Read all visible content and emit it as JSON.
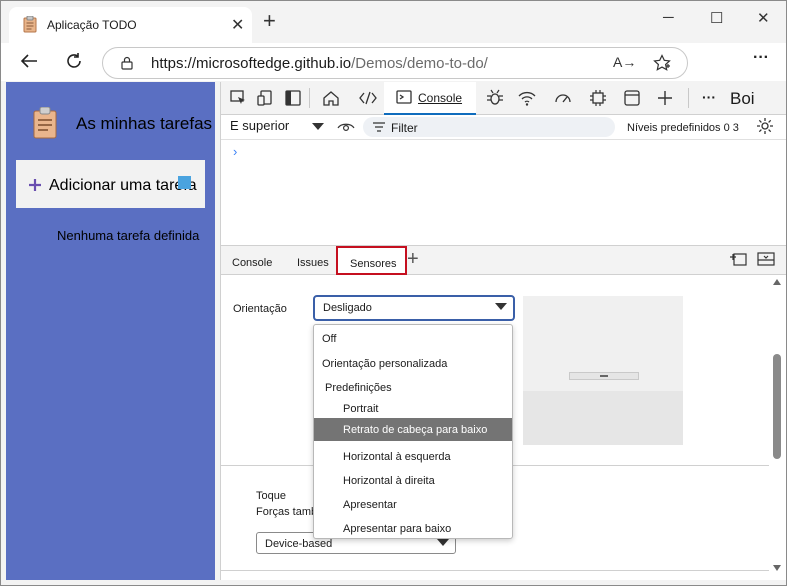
{
  "browser": {
    "tab_title": "Aplicação TODO",
    "tab_close": "✕",
    "new_tab": "+",
    "minimize": "─",
    "maximize": "☐",
    "close": "✕",
    "url_host": "https://microsoftedge.github.io",
    "url_path": "/Demos/demo-to-do/",
    "read_aloud": "A→",
    "menu": "···"
  },
  "app": {
    "title": "As minhas tarefas",
    "add_button": "Adicionar uma tarefa",
    "empty_text": "Nenhuma tarefa definida"
  },
  "devtools": {
    "console_tab": "Console",
    "more": "···",
    "profile": "Boi",
    "context": "E superior",
    "filter": "Filter",
    "levels": "Níveis predefinidos 0 3",
    "prompt": "›",
    "drawer_tabs": {
      "console": "Console",
      "issues": "Issues",
      "sensors": "Sensores",
      "add": "+"
    },
    "sensors": {
      "orientation_label": "Orientação",
      "orientation_value": "Desligado",
      "touch_label": "Toque",
      "forces_label": "Forças também",
      "device_select_value": "Device-based"
    },
    "orientation_options": {
      "off": "Off",
      "custom": "Orientação personalizada",
      "presets_header": "Predefinições",
      "portrait": "Portrait",
      "portrait_upside_down": "Retrato de cabeça para baixo",
      "landscape_left": "Horizontal à esquerda",
      "landscape_right": "Horizontal à direita",
      "display_up": "Apresentar",
      "display_down": "Apresentar para baixo"
    }
  },
  "colors": {
    "app_bg": "#5a6fc2",
    "accent": "#0f6cbd",
    "highlight_red": "#c50f1f",
    "selected_option": "#747474"
  }
}
